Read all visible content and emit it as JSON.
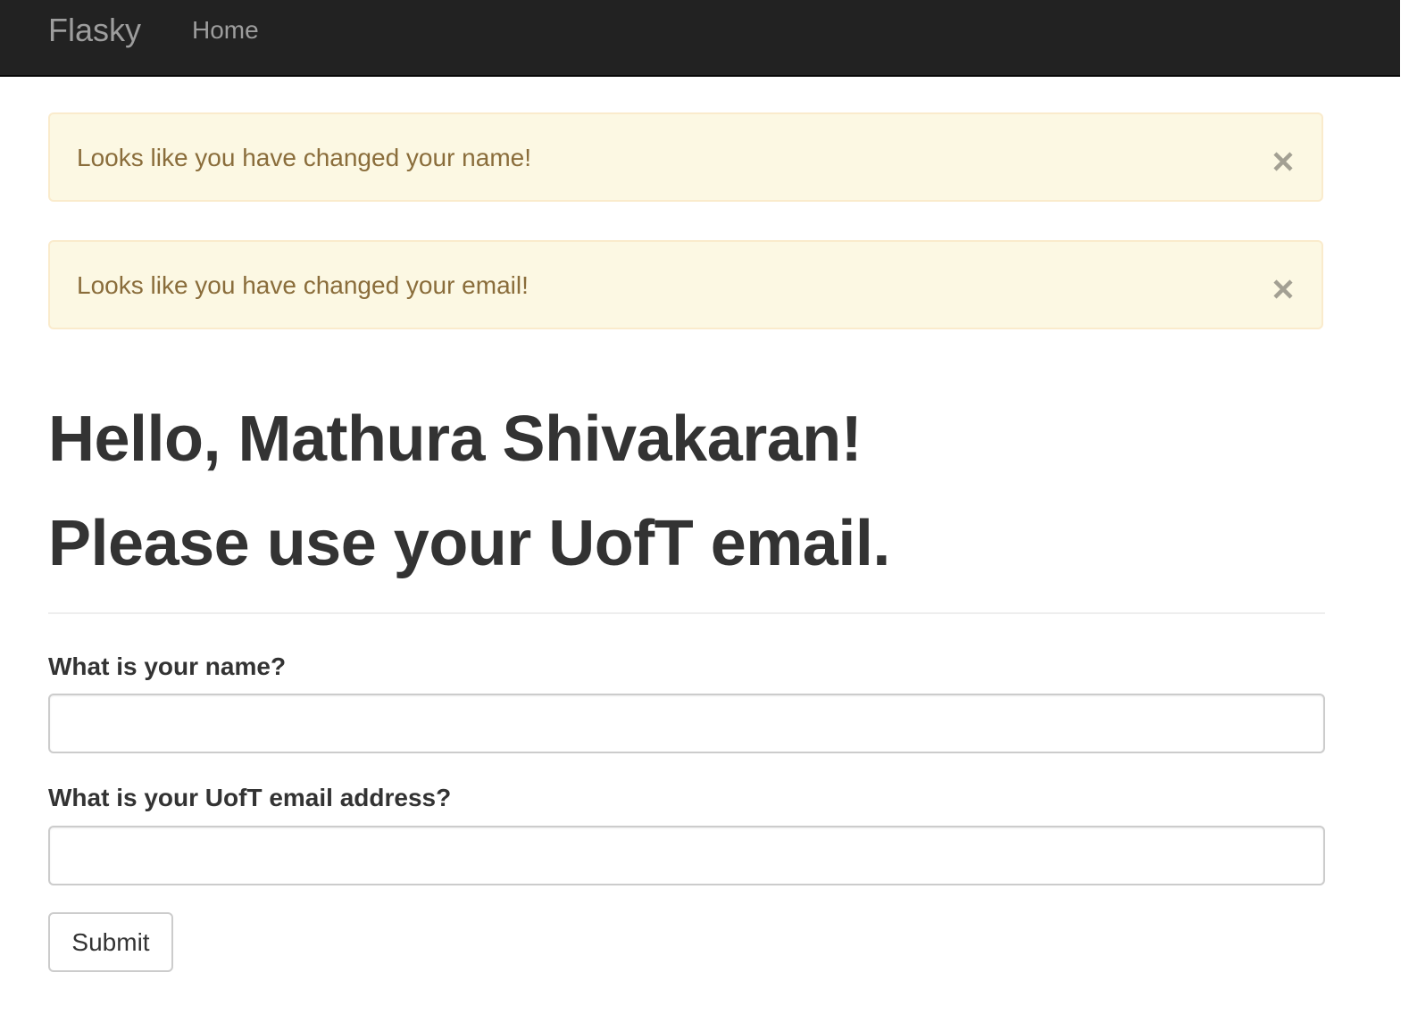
{
  "navbar": {
    "brand": "Flasky",
    "links": [
      {
        "label": "Home"
      }
    ]
  },
  "alerts": [
    {
      "message": "Looks like you have changed your name!",
      "close_symbol": "×"
    },
    {
      "message": "Looks like you have changed your email!",
      "close_symbol": "×"
    }
  ],
  "page": {
    "greeting": "Hello, Mathura Shivakaran!",
    "notice": "Please use your UofT email."
  },
  "form": {
    "name_label": "What is your name?",
    "name_value": "",
    "email_label": "What is your UofT email address?",
    "email_value": "",
    "submit_label": "Submit"
  },
  "colors": {
    "navbar_bg": "#222222",
    "navbar_text": "#9d9d9d",
    "alert_bg": "#fcf8e3",
    "alert_border": "#faebcc",
    "alert_text": "#8a6d3b",
    "heading_text": "#333333"
  }
}
